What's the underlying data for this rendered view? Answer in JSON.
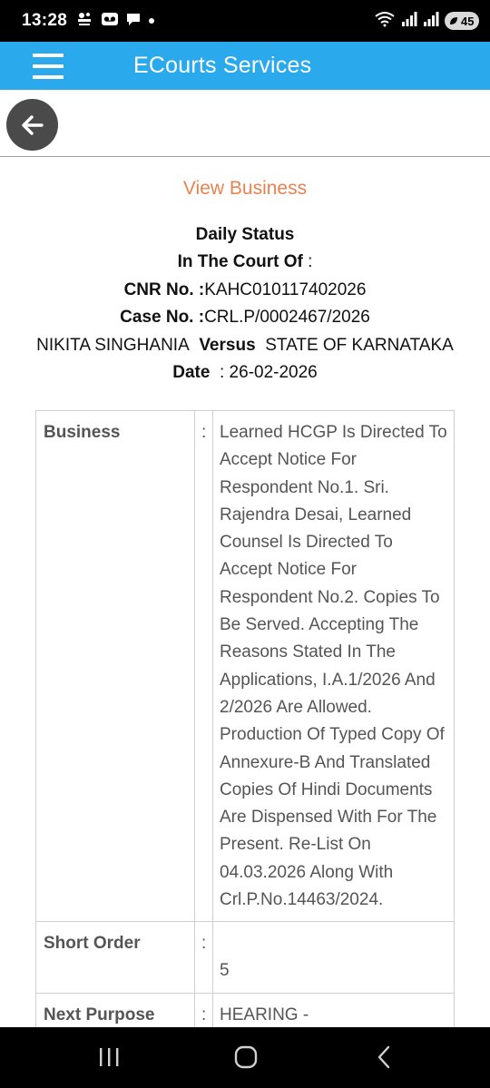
{
  "status_bar": {
    "time": "13:28",
    "battery": "45",
    "icons": [
      "app-notification-icon",
      "voicemail-icon",
      "chat-icon",
      "dot-icon",
      "wifi-icon",
      "signal-icon",
      "signal-icon",
      "battery-icon"
    ]
  },
  "app_bar": {
    "title": "ECourts Services",
    "background_color": "#2aa9ec"
  },
  "page": {
    "heading": "View Business",
    "heading_color": "#e8824f",
    "daily_status": "Daily Status",
    "in_the_court_of": "In The Court Of",
    "in_the_court_of_suffix": ":",
    "cnr_label": "CNR No. :",
    "cnr_value": "KAHC010117402026",
    "case_label": "Case No. :",
    "case_value": "CRL.P/0002467/2026",
    "petitioner": "NIKITA SINGHANIA",
    "versus": "Versus",
    "respondent": "STATE OF KARNATAKA",
    "date_label": "Date",
    "date_value": ": 26-02-2026"
  },
  "table": {
    "rows": [
      {
        "label": "Business",
        "colon": ":",
        "value": "Learned HCGP Is Directed To Accept Notice For Respondent No.1. Sri. Rajendra Desai, Learned Counsel Is Directed To Accept Notice For Respondent No.2. Copies To Be Served. Accepting The Reasons Stated In The Applications, I.A.1/2026 And 2/2026 Are Allowed. Production Of Typed Copy Of Annexure-B And Translated Copies Of Hindi Documents Are Dispensed With For The Present. Re-List On 04.03.2026 Along With Crl.P.No.14463/2024."
      },
      {
        "label": "Short Order",
        "colon": ":",
        "value": "5"
      },
      {
        "label": "Next Purpose",
        "colon": ":",
        "value": "HEARING -"
      }
    ]
  }
}
